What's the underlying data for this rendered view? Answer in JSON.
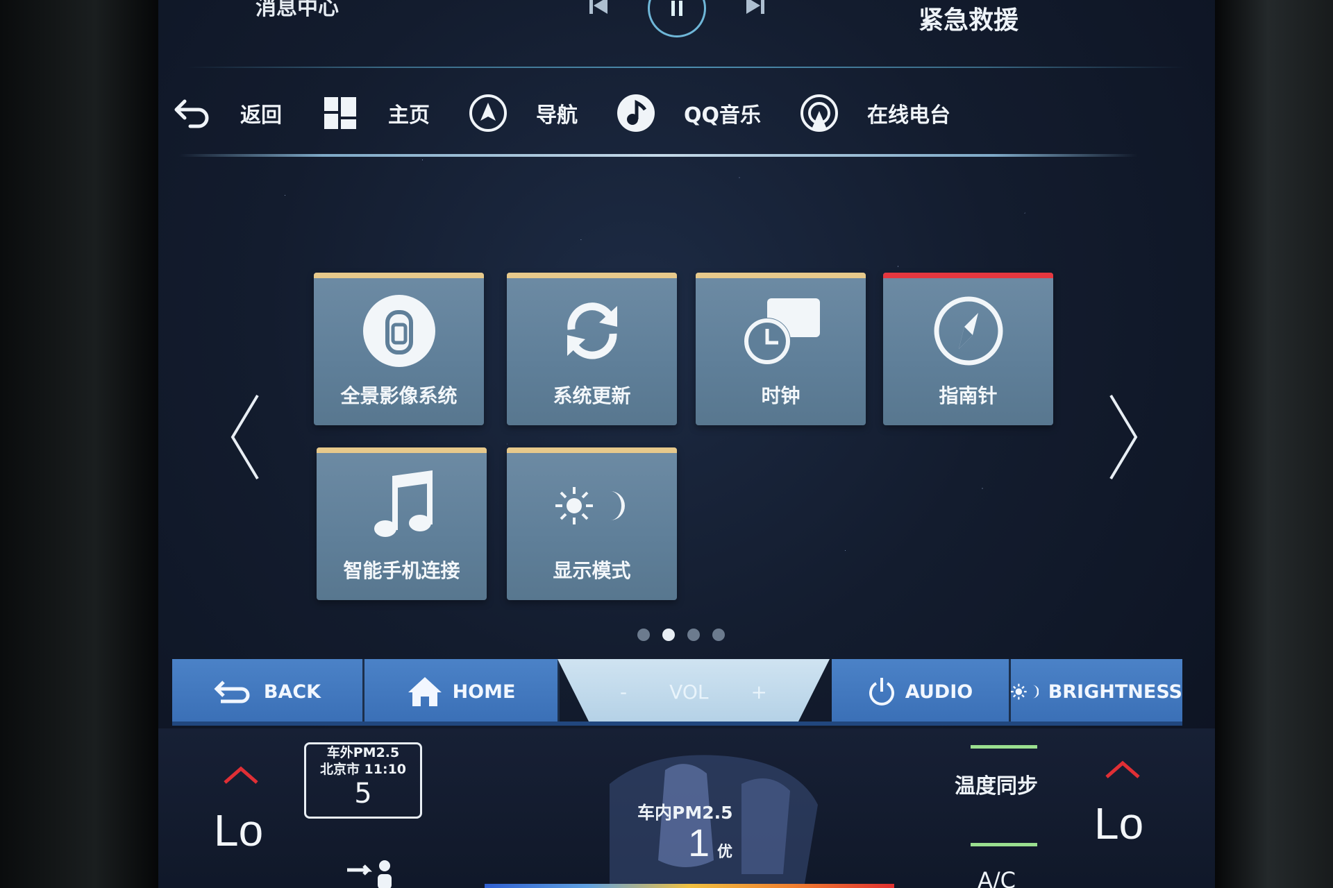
{
  "top": {
    "message_center": "消息中心",
    "emergency": "紧急救援",
    "media": {
      "prev_icon": "skip-previous-icon",
      "play_icon": "pause-icon",
      "next_icon": "skip-next-icon"
    }
  },
  "quicknav": [
    {
      "label": "返回",
      "icon": "back-arrow-icon"
    },
    {
      "label": "主页",
      "icon": "home-grid-icon"
    },
    {
      "label": "导航",
      "icon": "navigation-icon"
    },
    {
      "label": "QQ音乐",
      "icon": "qq-music-icon"
    },
    {
      "label": "在线电台",
      "icon": "online-radio-icon"
    }
  ],
  "apps": [
    {
      "label": "全景影像系统",
      "icon": "surround-view-icon",
      "accent": "#e7c98b"
    },
    {
      "label": "系统更新",
      "icon": "refresh-icon",
      "accent": "#e7c98b"
    },
    {
      "label": "时钟",
      "icon": "clock-icon",
      "accent": "#e7c98b"
    },
    {
      "label": "指南针",
      "icon": "compass-icon",
      "accent": "#e5373f"
    },
    {
      "label": "智能手机连接",
      "icon": "music-note-icon",
      "accent": "#e7c98b"
    },
    {
      "label": "显示模式",
      "icon": "sun-moon-icon",
      "accent": "#e7c98b"
    }
  ],
  "pager": {
    "current": 2,
    "total": 4
  },
  "softkeys": {
    "back": "BACK",
    "home": "HOME",
    "vol_minus": "-",
    "vol": "VOL",
    "vol_plus": "+",
    "audio": "AUDIO",
    "brightness": "BRIGHTNESS"
  },
  "climate": {
    "left_temp": "Lo",
    "right_temp": "Lo",
    "pm_outside_label": "车外PM2.5",
    "pm_outside_city_time": "北京市 11:10",
    "pm_outside_value": "5",
    "pm_inside_label": "车内PM2.5",
    "pm_inside_value": "1",
    "pm_inside_grade": "优",
    "temp_sync": "温度同步",
    "ac": "A/C"
  },
  "colors": {
    "softkey": "#3f75bc",
    "tile": "#63839d",
    "accent_gold": "#e7c98b",
    "accent_red": "#e5373f",
    "chevron_red": "#e02f35"
  }
}
